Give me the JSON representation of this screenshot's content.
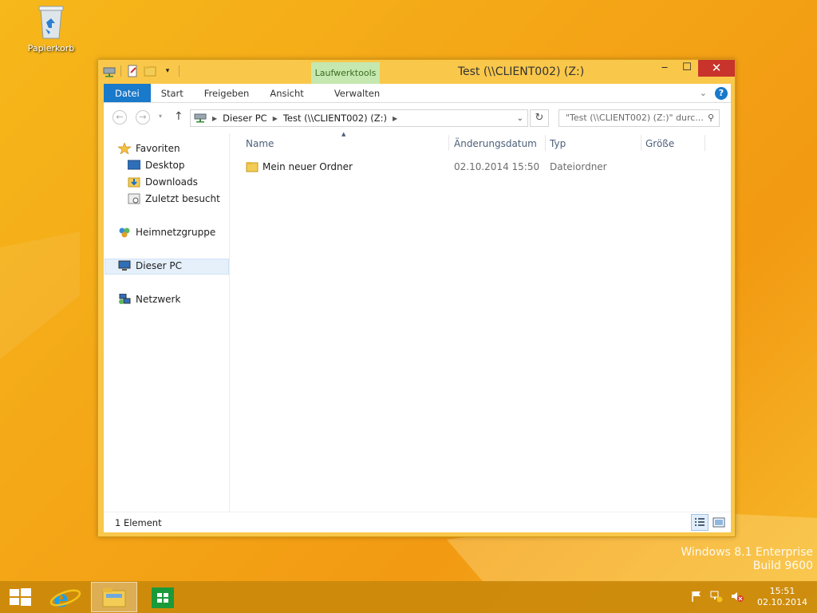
{
  "desktop": {
    "recycle_bin_label": "Papierkorb",
    "watermark_line1": "Windows 8.1 Enterprise",
    "watermark_line2": "Build 9600"
  },
  "window": {
    "title": "Test (\\\\CLIENT002) (Z:)",
    "context_tab_label": "Laufwerktools",
    "controls": {
      "minimize": "‒",
      "maximize": "☐",
      "close": "✕"
    }
  },
  "ribbon": {
    "tabs": [
      "Datei",
      "Start",
      "Freigeben",
      "Ansicht",
      "Verwalten"
    ],
    "help_label": "?"
  },
  "address_bar": {
    "segments": [
      "Dieser PC",
      "Test (\\\\CLIENT002) (Z:)"
    ],
    "search_placeholder": "\"Test (\\\\CLIENT002) (Z:)\" durc..."
  },
  "nav_pane": {
    "favorites": "Favoriten",
    "favorite_items": [
      "Desktop",
      "Downloads",
      "Zuletzt besucht"
    ],
    "homegroup": "Heimnetzgruppe",
    "this_pc": "Dieser PC",
    "network": "Netzwerk"
  },
  "columns": [
    "Name",
    "Änderungsdatum",
    "Typ",
    "Größe"
  ],
  "files": [
    {
      "name": "Mein neuer Ordner",
      "modified": "02.10.2014 15:50",
      "type": "Dateiordner",
      "size": ""
    }
  ],
  "status": {
    "item_count": "1 Element"
  },
  "taskbar": {
    "time": "15:51",
    "date": "02.10.2014"
  },
  "colors": {
    "accent": "#1979ca",
    "context_tab": "#c5e8b0",
    "close": "#c8332b"
  }
}
